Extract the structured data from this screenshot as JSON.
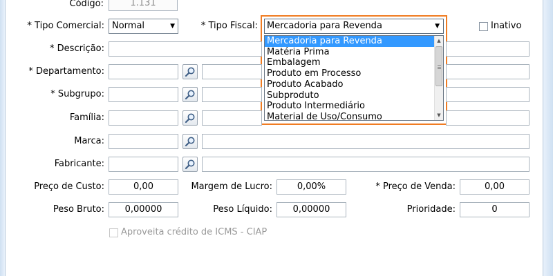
{
  "form": {
    "codigo": {
      "label": "Código:",
      "value": "1.131"
    },
    "tipo_comercial": {
      "label": "* Tipo Comercial:",
      "value": "Normal"
    },
    "tipo_fiscal": {
      "label": "* Tipo Fiscal:",
      "value": "Mercadoria para Revenda",
      "options": [
        "Mercadoria para Revenda",
        "Matéria Prima",
        "Embalagem",
        "Produto em Processo",
        "Produto Acabado",
        "Subproduto",
        "Produto Intermediário",
        "Material de Uso/Consumo"
      ],
      "selected_index": 0
    },
    "inativo": {
      "label": "Inativo",
      "checked": false
    },
    "descricao": {
      "label": "* Descrição:",
      "value": ""
    },
    "departamento": {
      "label": "* Departamento:",
      "code": "",
      "name": ""
    },
    "subgrupo": {
      "label": "* Subgrupo:",
      "code": "",
      "name": ""
    },
    "familia": {
      "label": "Família:",
      "code": "",
      "name": ""
    },
    "marca": {
      "label": "Marca:",
      "code": "",
      "name": ""
    },
    "fabricante": {
      "label": "Fabricante:",
      "code": "",
      "name": ""
    },
    "preco_custo": {
      "label": "Preço de Custo:",
      "value": "0,00"
    },
    "margem_lucro": {
      "label": "Margem de Lucro:",
      "value": "0,00%"
    },
    "preco_venda": {
      "label": "* Preço de Venda:",
      "value": "0,00"
    },
    "peso_bruto": {
      "label": "Peso Bruto:",
      "value": "0,00000"
    },
    "peso_liquido": {
      "label": "Peso Líquido:",
      "value": "0,00000"
    },
    "prioridade": {
      "label": "Prioridade:",
      "value": "0"
    },
    "ciap": {
      "label": "Aproveita crédito de ICMS - CIAP",
      "checked": false,
      "disabled": true
    }
  },
  "icons": {
    "lookup": "magnifier-icon",
    "dropdown": "chevron-down-icon"
  },
  "colors": {
    "highlight_border": "#f07c22",
    "selected_option": "#3399ff",
    "window_frame": "#cfe0f2"
  }
}
